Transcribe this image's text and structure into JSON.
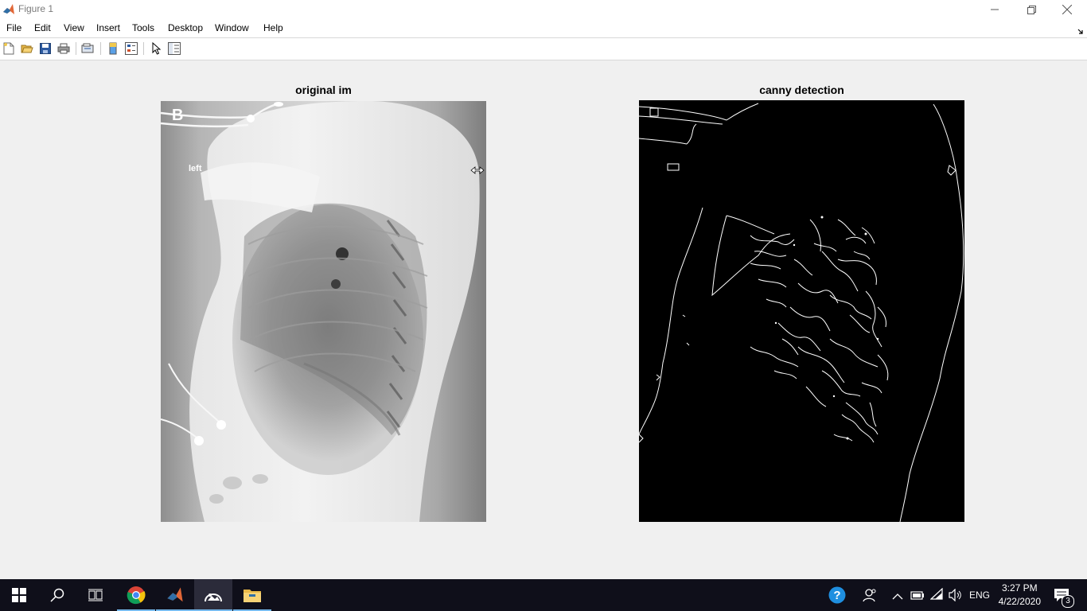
{
  "window": {
    "title": "Figure 1",
    "app_icon": "matlab-icon"
  },
  "menu": {
    "items": [
      "File",
      "Edit",
      "View",
      "Insert",
      "Tools",
      "Desktop",
      "Window",
      "Help"
    ]
  },
  "toolbar": {
    "icons": [
      "new-figure-icon",
      "open-file-icon",
      "save-icon",
      "print-icon",
      "link-plot-icon",
      "insert-colorbar-icon",
      "insert-legend-icon",
      "edit-plot-icon",
      "property-editor-icon"
    ]
  },
  "figure": {
    "left_axes": {
      "title": "original im",
      "image_label_b": "B",
      "image_label_left": "left"
    },
    "right_axes": {
      "title": "canny detection"
    }
  },
  "taskbar": {
    "apps": [
      "start-icon",
      "search-icon",
      "task-view-icon",
      "chrome-icon",
      "matlab-icon",
      "photos-icon",
      "file-explorer-icon"
    ],
    "language": "ENG",
    "time": "3:27 PM",
    "date": "4/22/2020",
    "notification_count": "3"
  },
  "colors": {
    "taskbar_bg": "#0f0f1a",
    "figure_bg": "#f0f0f0",
    "accent": "#76b9ed"
  }
}
